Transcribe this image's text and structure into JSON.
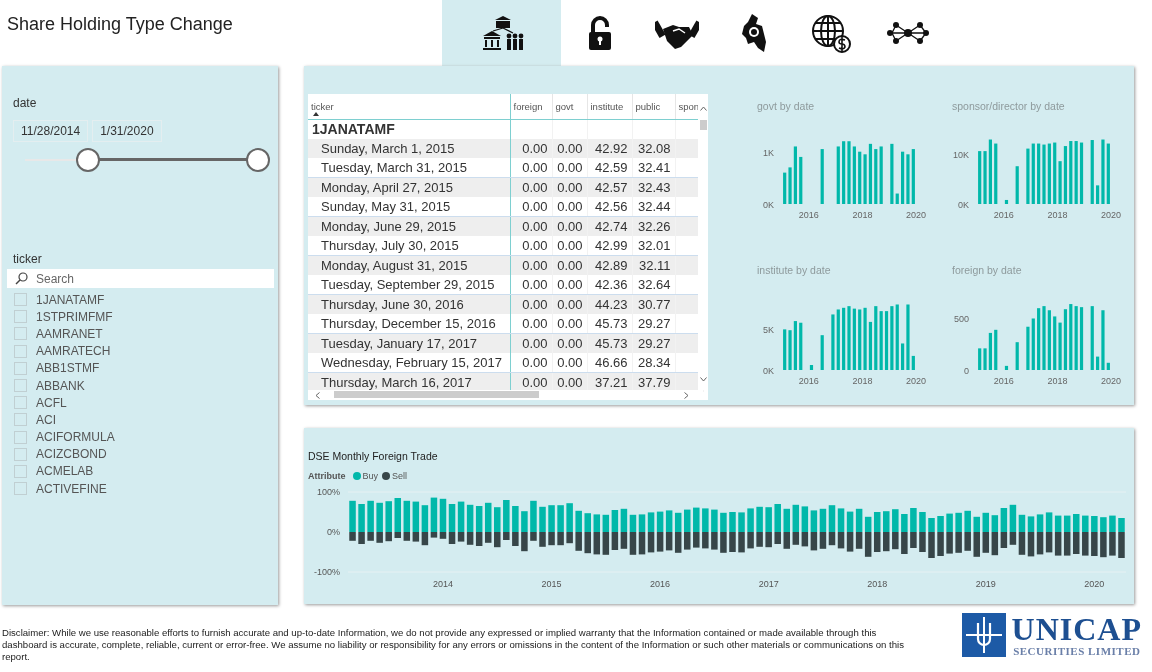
{
  "title": "Share Holding Type Change",
  "tabs": [
    {
      "kind": "institution",
      "selected": true
    },
    {
      "kind": "lock",
      "selected": false
    },
    {
      "kind": "handshake",
      "selected": false
    },
    {
      "kind": "map",
      "selected": false
    },
    {
      "kind": "globe",
      "selected": false
    },
    {
      "kind": "network",
      "selected": false
    }
  ],
  "date_slicer": {
    "label": "date",
    "start": "11/28/2014",
    "end": "1/31/2020",
    "thumbs": [
      {
        "level": 0.27
      },
      {
        "level": 1
      }
    ]
  },
  "ticker_slicer": {
    "label": "ticker",
    "placeholder": "Search",
    "items": [
      {
        "label": "1JANATAMF",
        "checked": false
      },
      {
        "label": "1STPRIMFMF",
        "checked": false
      },
      {
        "label": "AAMRANET",
        "checked": false
      },
      {
        "label": "AAMRATECH",
        "checked": false
      },
      {
        "label": "ABB1STMF",
        "checked": false
      },
      {
        "label": "ABBANK",
        "checked": false
      },
      {
        "label": "ACFL",
        "checked": false
      },
      {
        "label": "ACI",
        "checked": false
      },
      {
        "label": "ACIFORMULA",
        "checked": false
      },
      {
        "label": "ACIZCBOND",
        "checked": false
      },
      {
        "label": "ACMELAB",
        "checked": false
      },
      {
        "label": "ACTIVEFINE",
        "checked": false
      }
    ]
  },
  "table": {
    "columns": [
      "ticker",
      "foreign",
      "govt",
      "institute",
      "public",
      "spon"
    ],
    "group": "1JANATAMF",
    "rows": [
      [
        "Sunday, March 1, 2015",
        "0.00",
        "0.00",
        "42.92",
        "32.08"
      ],
      [
        "Tuesday, March 31, 2015",
        "0.00",
        "0.00",
        "42.59",
        "32.41"
      ],
      [
        "Monday, April 27, 2015",
        "0.00",
        "0.00",
        "42.57",
        "32.43"
      ],
      [
        "Sunday, May 31, 2015",
        "0.00",
        "0.00",
        "42.56",
        "32.44"
      ],
      [
        "Monday, June 29, 2015",
        "0.00",
        "0.00",
        "42.74",
        "32.26"
      ],
      [
        "Thursday, July 30, 2015",
        "0.00",
        "0.00",
        "42.99",
        "32.01"
      ],
      [
        "Monday, August 31, 2015",
        "0.00",
        "0.00",
        "42.89",
        "32.11"
      ],
      [
        "Tuesday, September 29, 2015",
        "0.00",
        "0.00",
        "42.36",
        "32.64"
      ],
      [
        "Thursday, June 30, 2016",
        "0.00",
        "0.00",
        "44.23",
        "30.77"
      ],
      [
        "Thursday, December 15, 2016",
        "0.00",
        "0.00",
        "45.73",
        "29.27"
      ],
      [
        "Tuesday, January 17, 2017",
        "0.00",
        "0.00",
        "45.73",
        "29.27"
      ],
      [
        "Wednesday, February 15, 2017",
        "0.00",
        "0.00",
        "46.66",
        "28.34"
      ],
      [
        "Thursday, March 16, 2017",
        "0.00",
        "0.00",
        "37.21",
        "37.79"
      ]
    ]
  },
  "mini_charts": [
    {
      "chart_data": {
        "type": "bar",
        "title": "govt by date",
        "xlim": [
          2015,
          2020
        ],
        "ylim": [
          0,
          1300
        ],
        "yticks": [
          {
            "value": 0,
            "label": "0K"
          },
          {
            "value": 1000,
            "label": "1K"
          }
        ],
        "xticks": [
          2016,
          2018,
          2020
        ],
        "x": [
          2015.1,
          2015.3,
          2015.5,
          2015.7,
          2015.9,
          2016.1,
          2016.3,
          2016.5,
          2016.7,
          2016.9,
          2017.1,
          2017.3,
          2017.5,
          2017.7,
          2017.9,
          2018.1,
          2018.3,
          2018.5,
          2018.7,
          2018.9,
          2019.1,
          2019.3,
          2019.5,
          2019.7,
          2019.9
        ],
        "values": [
          600,
          700,
          1100,
          900,
          null,
          null,
          null,
          1050,
          null,
          null,
          1100,
          1200,
          1200,
          1100,
          1000,
          950,
          1150,
          1050,
          1100,
          null,
          1150,
          200,
          1000,
          950,
          1050
        ]
      }
    },
    {
      "chart_data": {
        "type": "bar",
        "title": "sponsor/director by date",
        "xlim": [
          2015,
          2020
        ],
        "ylim": [
          0,
          13500
        ],
        "yticks": [
          {
            "value": 0,
            "label": "0K"
          },
          {
            "value": 10000,
            "label": "10K"
          }
        ],
        "xticks": [
          2016,
          2018,
          2020
        ],
        "x": [
          2015.1,
          2015.3,
          2015.5,
          2015.7,
          2015.9,
          2016.1,
          2016.3,
          2016.5,
          2016.7,
          2016.9,
          2017.1,
          2017.3,
          2017.5,
          2017.7,
          2017.9,
          2018.1,
          2018.3,
          2018.5,
          2018.7,
          2018.9,
          2019.1,
          2019.3,
          2019.5,
          2019.7,
          2019.9
        ],
        "values": [
          10500,
          10500,
          12800,
          12000,
          null,
          800,
          null,
          7500,
          null,
          11000,
          12000,
          12000,
          11800,
          12000,
          12200,
          8500,
          11500,
          12500,
          12500,
          12200,
          null,
          12700,
          3700,
          12800,
          12000
        ]
      }
    },
    {
      "chart_data": {
        "type": "bar",
        "title": "institute by date",
        "xlim": [
          2015,
          2020
        ],
        "ylim": [
          0,
          8200
        ],
        "yticks": [
          {
            "value": 0,
            "label": "0K"
          },
          {
            "value": 5000,
            "label": "5K"
          }
        ],
        "xticks": [
          2016,
          2018,
          2020
        ],
        "x": [
          2015.1,
          2015.3,
          2015.5,
          2015.7,
          2015.9,
          2016.1,
          2016.3,
          2016.5,
          2016.7,
          2016.9,
          2017.1,
          2017.3,
          2017.5,
          2017.7,
          2017.9,
          2018.1,
          2018.3,
          2018.5,
          2018.7,
          2018.9,
          2019.1,
          2019.3,
          2019.5,
          2019.7,
          2019.9
        ],
        "values": [
          4900,
          4800,
          5900,
          5700,
          null,
          600,
          null,
          4200,
          null,
          6700,
          7300,
          7500,
          7700,
          7400,
          7300,
          7500,
          5800,
          7700,
          7100,
          7100,
          7700,
          7900,
          3200,
          7900,
          1700
        ]
      }
    },
    {
      "chart_data": {
        "type": "bar",
        "title": "foreign by date",
        "xlim": [
          2015,
          2020
        ],
        "ylim": [
          0,
          660
        ],
        "yticks": [
          {
            "value": 0,
            "label": "0"
          },
          {
            "value": 500,
            "label": "500"
          }
        ],
        "xticks": [
          2016,
          2018,
          2020
        ],
        "x": [
          2015.1,
          2015.3,
          2015.5,
          2015.7,
          2015.9,
          2016.1,
          2016.3,
          2016.5,
          2016.7,
          2016.9,
          2017.1,
          2017.3,
          2017.5,
          2017.7,
          2017.9,
          2018.1,
          2018.3,
          2018.5,
          2018.7,
          2018.9,
          2019.1,
          2019.3,
          2019.5,
          2019.7,
          2019.9
        ],
        "values": [
          210,
          210,
          360,
          390,
          null,
          40,
          null,
          270,
          null,
          420,
          500,
          600,
          620,
          580,
          520,
          460,
          590,
          640,
          620,
          610,
          null,
          620,
          130,
          580,
          70
        ]
      }
    }
  ],
  "trade_chart": {
    "legend_title": "Attribute",
    "chart_data": {
      "type": "bar",
      "title": "DSE Monthly Foreign Trade",
      "legend": "top-left",
      "stacked": true,
      "ylim": [
        -100,
        100
      ],
      "yticks": [
        {
          "value": 100,
          "label": "100%"
        },
        {
          "value": 0,
          "label": "0%"
        },
        {
          "value": -100,
          "label": "-100%"
        }
      ],
      "categories": [
        null,
        null,
        null,
        null,
        null,
        null,
        null,
        null,
        null,
        null,
        "2014",
        null,
        null,
        null,
        null,
        null,
        null,
        null,
        null,
        null,
        null,
        null,
        "2015",
        null,
        null,
        null,
        null,
        null,
        null,
        null,
        null,
        null,
        null,
        null,
        "2016",
        null,
        null,
        null,
        null,
        null,
        null,
        null,
        null,
        null,
        null,
        null,
        "2017",
        null,
        null,
        null,
        null,
        null,
        null,
        null,
        null,
        null,
        null,
        null,
        "2018",
        null,
        null,
        null,
        null,
        null,
        null,
        null,
        null,
        null,
        null,
        null,
        "2019",
        null,
        null,
        null,
        null,
        null,
        null,
        null,
        null,
        null,
        null,
        null,
        "2020",
        null,
        null,
        null
      ],
      "series": [
        {
          "name": "Buy",
          "color": "#01b8aa",
          "values": [
            78,
            70,
            78,
            73,
            77,
            85,
            78,
            76,
            67,
            86,
            83,
            70,
            76,
            68,
            65,
            73,
            62,
            80,
            65,
            52,
            78,
            63,
            67,
            67,
            72,
            53,
            47,
            44,
            43,
            55,
            58,
            43,
            44,
            49,
            51,
            54,
            48,
            56,
            61,
            59,
            56,
            48,
            50,
            49,
            59,
            63,
            62,
            70,
            58,
            68,
            64,
            54,
            58,
            67,
            59,
            51,
            58,
            38,
            50,
            52,
            57,
            45,
            60,
            50,
            35,
            40,
            46,
            48,
            53,
            38,
            48,
            42,
            60,
            68,
            43,
            39,
            44,
            49,
            41,
            41,
            45,
            41,
            40,
            37,
            41,
            35
          ]
        },
        {
          "name": "Sell",
          "color": "#374649",
          "values": [
            -22,
            -30,
            -22,
            -27,
            -23,
            -15,
            -22,
            -24,
            -33,
            -14,
            -17,
            -30,
            -24,
            -32,
            -35,
            -27,
            -38,
            -20,
            -35,
            -48,
            -22,
            -37,
            -33,
            -33,
            -28,
            -47,
            -53,
            -56,
            -57,
            -45,
            -42,
            -57,
            -56,
            -51,
            -49,
            -46,
            -52,
            -44,
            -39,
            -41,
            -44,
            -52,
            -50,
            -51,
            -41,
            -37,
            -38,
            -30,
            -42,
            -32,
            -36,
            -46,
            -42,
            -33,
            -41,
            -49,
            -42,
            -62,
            -50,
            -48,
            -43,
            -55,
            -40,
            -50,
            -65,
            -60,
            -54,
            -52,
            -47,
            -62,
            -52,
            -58,
            -40,
            -32,
            -57,
            -61,
            -56,
            -51,
            -59,
            -59,
            -55,
            -59,
            -60,
            -63,
            -59,
            -65
          ]
        }
      ]
    }
  },
  "disclaimer": "Disclaimer: While we use reasonable efforts to furnish accurate and up-to-date Information, we do not provide any expressed or implied warranty that the Information contained or made available through this dashboard is accurate, complete, reliable, current or error-free.  We assume no liability or responsibility for any errors or omissions in the content of the Information or such other materials or communications on this report.",
  "logo": {
    "name": "UNICAP",
    "subtitle": "SECURITIES LIMITED"
  }
}
